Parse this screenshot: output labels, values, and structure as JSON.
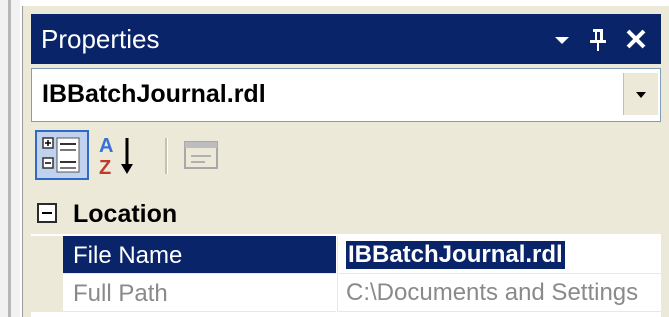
{
  "window": {
    "title": "Properties"
  },
  "selector": {
    "value": "IBBatchJournal.rdl"
  },
  "toolbar": {
    "categorized_icon": "categorized-icon",
    "alphabetical_icon": "alphabetical-sort-icon",
    "property_pages_icon": "property-pages-icon"
  },
  "category": {
    "label": "Location"
  },
  "properties": [
    {
      "name": "File Name",
      "value": "IBBatchJournal.rdl"
    },
    {
      "name": "Full Path",
      "value": "C:\\Documents and Settings"
    }
  ],
  "colors": {
    "titlebar": "#0a246a",
    "panel": "#ece9d8",
    "selection": "#0a246a"
  }
}
